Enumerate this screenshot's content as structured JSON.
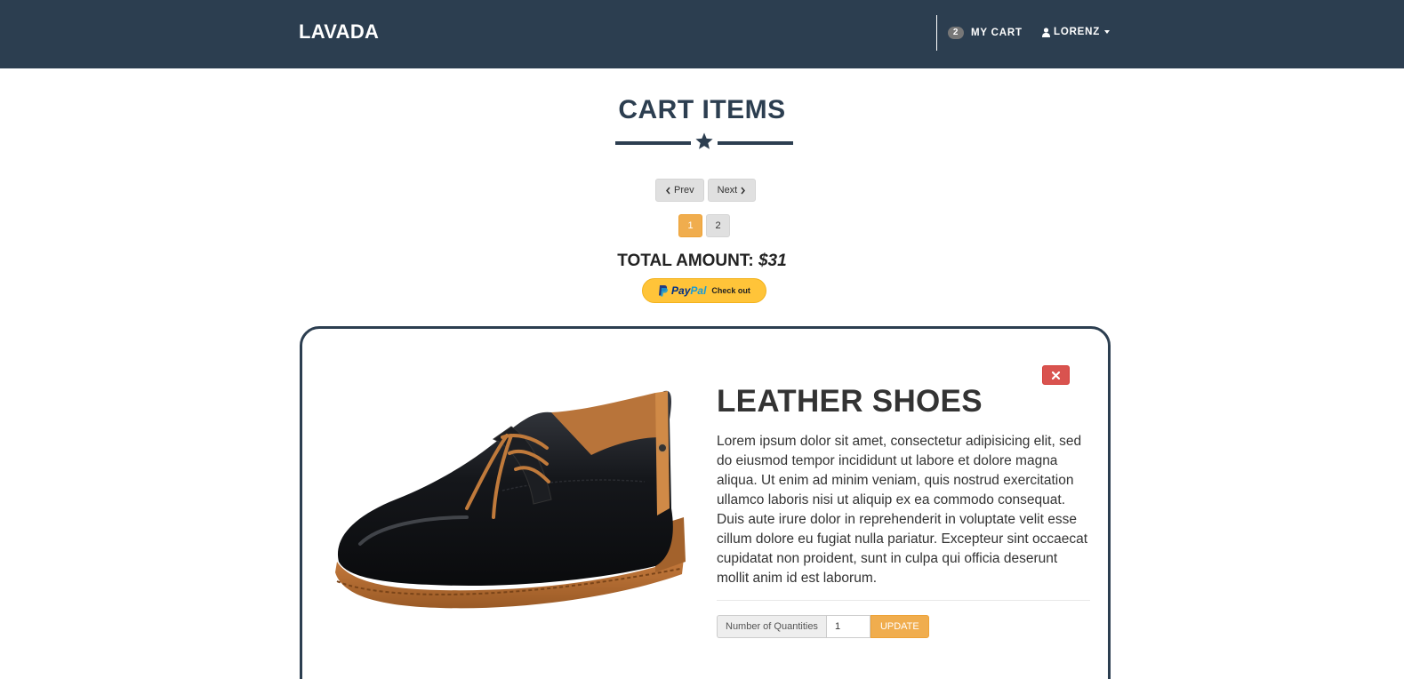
{
  "navbar": {
    "brand": "LAVADA",
    "cart_count": "2",
    "cart_label": "MY CART",
    "user_label": "LORENZ"
  },
  "page": {
    "title": "CART ITEMS"
  },
  "pager": {
    "prev_label": "Prev",
    "next_label": "Next"
  },
  "pagination": {
    "pages": [
      "1",
      "2"
    ],
    "active_page": "1"
  },
  "total": {
    "label": "TOTAL AMOUNT:",
    "amount": "$31"
  },
  "paypal": {
    "brand_pay": "Pay",
    "brand_pal": "Pal",
    "action": "Check out"
  },
  "item": {
    "title": "LEATHER SHOES",
    "description": "Lorem ipsum dolor sit amet, consectetur adipisicing elit, sed do eiusmod tempor incididunt ut labore et dolore magna aliqua. Ut enim ad minim veniam, quis nostrud exercitation ullamco laboris nisi ut aliquip ex ea commodo consequat. Duis aute irure dolor in reprehenderit in voluptate velit esse cillum dolore eu fugiat nulla pariatur. Excepteur sint occaecat cupidatat non proident, sunt in culpa qui officia deserunt mollit anim id est laborum.",
    "qty_label": "Number of Quantities",
    "qty_value": "1",
    "update_label": "UPDATE",
    "image_icon": "leather-shoe-image",
    "remove_icon": "close-icon"
  },
  "colors": {
    "navbar": "#2c3e50",
    "accent": "#f0ad4e",
    "danger": "#d9534f",
    "paypal": "#ffc439"
  }
}
